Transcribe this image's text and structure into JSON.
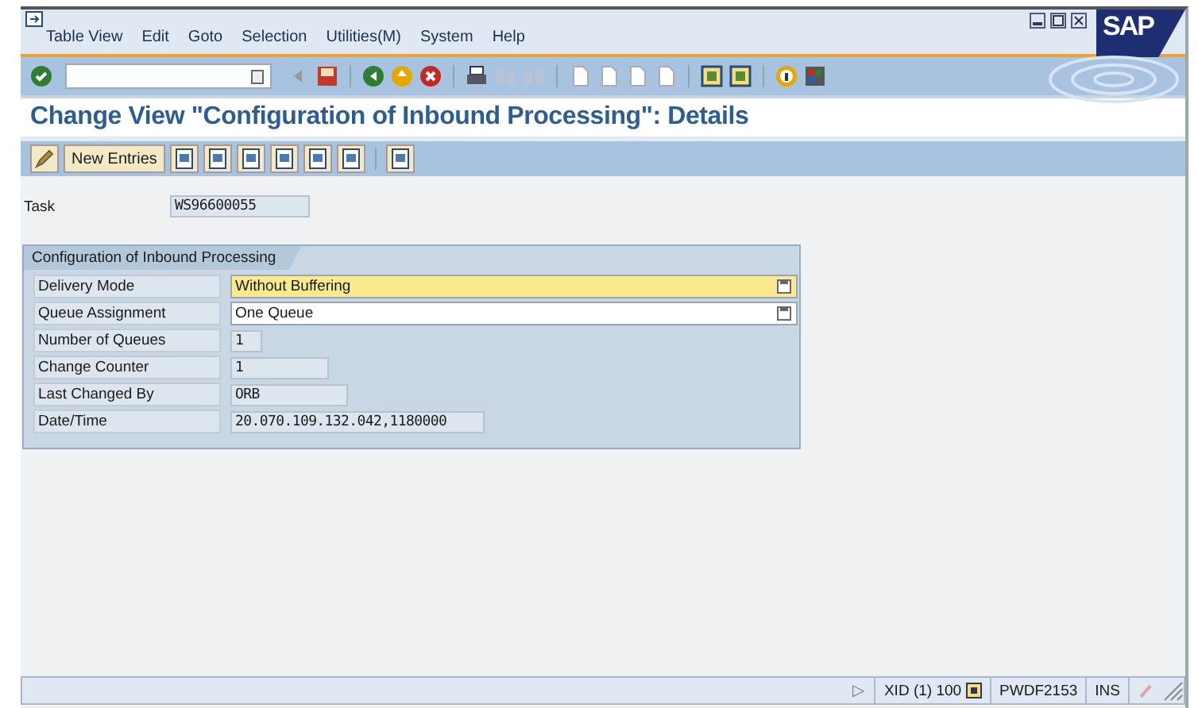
{
  "menu_bar": {
    "items": [
      "Table View",
      "Edit",
      "Goto",
      "Selection",
      "Utilities(M)",
      "System",
      "Help"
    ],
    "logo": "SAP"
  },
  "toolbar": {
    "items": [
      {
        "kind": "icon"
      },
      {
        "kind": "command"
      },
      {
        "kind": "icon"
      },
      {
        "kind": "icon"
      },
      {
        "kind": "sep"
      },
      {
        "kind": "icon"
      },
      {
        "kind": "icon"
      },
      {
        "kind": "icon"
      },
      {
        "kind": "sep"
      },
      {
        "kind": "icon"
      },
      {
        "kind": "icon"
      },
      {
        "kind": "icon"
      },
      {
        "kind": "sep"
      },
      {
        "kind": "icon"
      },
      {
        "kind": "icon"
      },
      {
        "kind": "icon"
      },
      {
        "kind": "icon"
      },
      {
        "kind": "sep"
      },
      {
        "kind": "icon"
      },
      {
        "kind": "icon"
      },
      {
        "kind": "sep"
      },
      {
        "kind": "icon"
      },
      {
        "kind": "icon"
      }
    ]
  },
  "title": "Change View \"Configuration of Inbound Processing\": Details",
  "app_toolbar": {
    "items": [
      {
        "kind": "icon"
      },
      {
        "kind": "button",
        "label": "New Entries"
      },
      {
        "kind": "icon"
      },
      {
        "kind": "icon"
      },
      {
        "kind": "icon"
      },
      {
        "kind": "icon"
      },
      {
        "kind": "icon"
      },
      {
        "kind": "icon"
      },
      {
        "kind": "sep"
      },
      {
        "kind": "icon"
      }
    ]
  },
  "task": {
    "label": "Task",
    "value": "WS96600055"
  },
  "group": {
    "title": "Configuration of Inbound Processing",
    "fields": [
      {
        "label": "Delivery Mode",
        "value": "Without Buffering",
        "kind": "dropdown",
        "focused": true
      },
      {
        "label": "Queue Assignment",
        "value": "One Queue",
        "kind": "dropdown",
        "focused": false
      },
      {
        "label": "Number of Queues",
        "value": "1",
        "kind": "display"
      },
      {
        "label": "Change Counter",
        "value": "1",
        "kind": "display"
      },
      {
        "label": "Last Changed By",
        "value": "ORB",
        "kind": "display"
      },
      {
        "label": "Date/Time",
        "value": "20.070.109.132.042,1180000",
        "kind": "display"
      }
    ]
  },
  "status_bar": {
    "arrow": "▷",
    "system": "XID (1) 100",
    "server": "PWDF2153",
    "mode": "INS"
  }
}
